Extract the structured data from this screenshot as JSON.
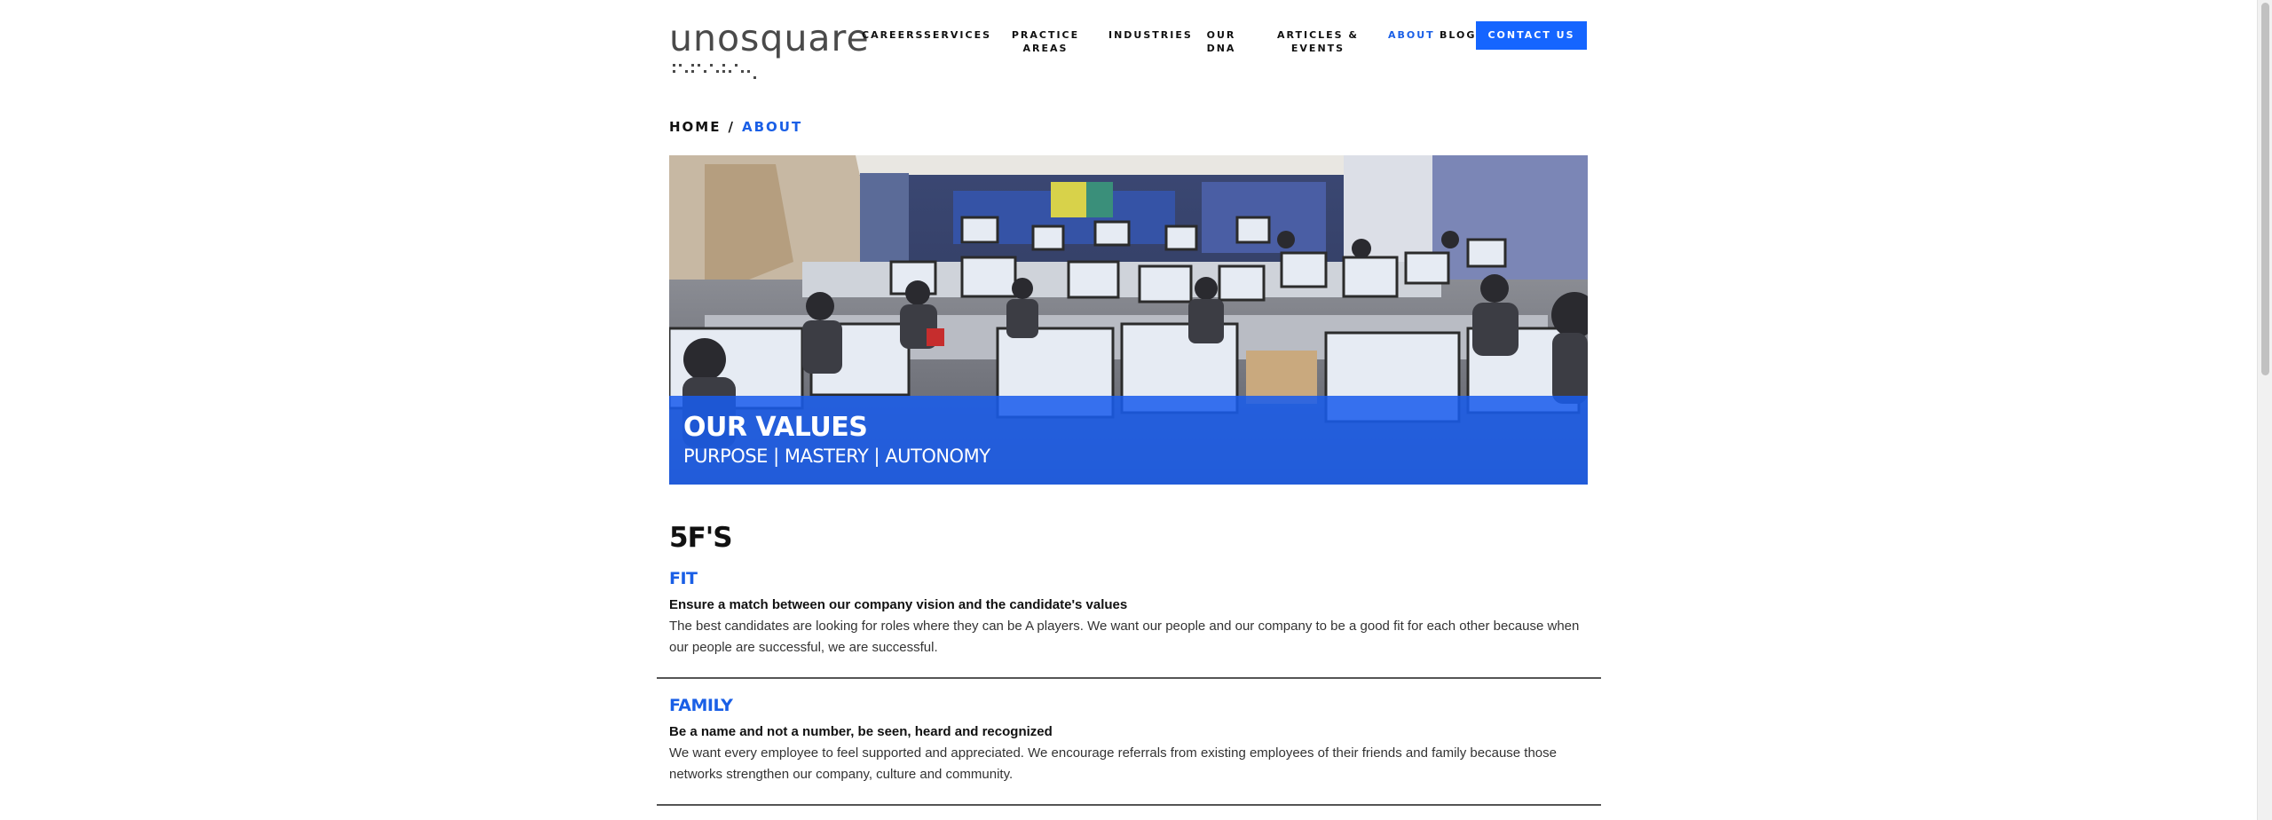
{
  "header": {
    "logo_text": "unosquare",
    "nav": [
      {
        "label": "CAREERS",
        "lines": [
          "CAREERS"
        ],
        "active": false
      },
      {
        "label": "SERVICES",
        "lines": [
          "SERVICES"
        ],
        "active": false
      },
      {
        "label": "PRACTICE AREAS",
        "lines": [
          "PRACTICE",
          "AREAS"
        ],
        "active": false
      },
      {
        "label": "INDUSTRIES",
        "lines": [
          "INDUSTRIES"
        ],
        "active": false
      },
      {
        "label": "OUR DNA",
        "lines": [
          "OUR",
          "DNA"
        ],
        "active": false
      },
      {
        "label": "ARTICLES & EVENTS",
        "lines": [
          "ARTICLES &",
          "EVENTS"
        ],
        "active": false
      },
      {
        "label": "ABOUT",
        "lines": [
          "ABOUT"
        ],
        "active": true
      },
      {
        "label": "BLOG",
        "lines": [
          "BLOG"
        ],
        "active": false
      }
    ],
    "contact_label": "CONTACT US"
  },
  "breadcrumb": {
    "home": "HOME",
    "separator": "/",
    "current": "ABOUT"
  },
  "hero": {
    "title": "OUR VALUES",
    "subtitle": "PURPOSE | MASTERY | AUTONOMY"
  },
  "section": {
    "title": "5F'S",
    "values": [
      {
        "name": "FIT",
        "tagline": "Ensure a match between our company vision and the candidate's values",
        "description": "The best candidates are looking for roles where they can be A players. We want our people and our company to be a good fit for each other because when our people are successful, we are successful."
      },
      {
        "name": "FAMILY",
        "tagline": "Be a name and not a number, be seen, heard and recognized",
        "description": "We want every employee to feel supported and appreciated. We encourage referrals from existing employees of their friends and family because those networks strengthen our company, culture and community."
      }
    ]
  },
  "colors": {
    "accent": "#1a5fe6",
    "button": "#1565ff",
    "hero_band": "#185cec"
  }
}
